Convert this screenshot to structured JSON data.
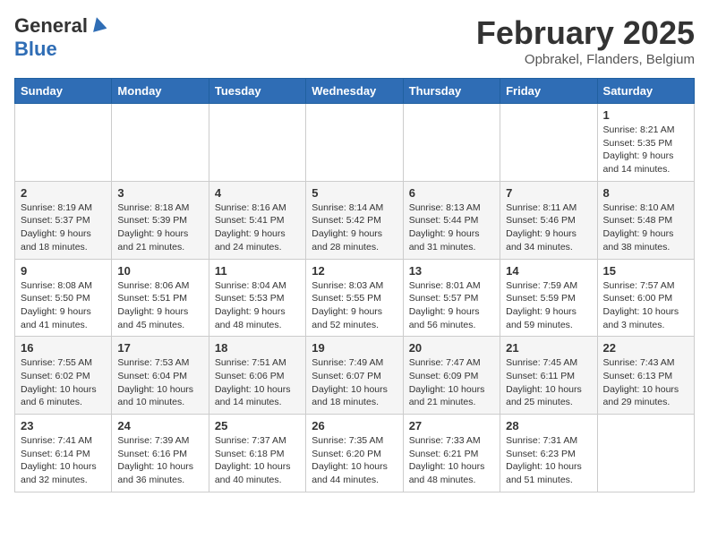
{
  "header": {
    "logo_general": "General",
    "logo_blue": "Blue",
    "month_title": "February 2025",
    "location": "Opbrakel, Flanders, Belgium"
  },
  "days_of_week": [
    "Sunday",
    "Monday",
    "Tuesday",
    "Wednesday",
    "Thursday",
    "Friday",
    "Saturday"
  ],
  "weeks": [
    [
      {
        "day": "",
        "info": ""
      },
      {
        "day": "",
        "info": ""
      },
      {
        "day": "",
        "info": ""
      },
      {
        "day": "",
        "info": ""
      },
      {
        "day": "",
        "info": ""
      },
      {
        "day": "",
        "info": ""
      },
      {
        "day": "1",
        "info": "Sunrise: 8:21 AM\nSunset: 5:35 PM\nDaylight: 9 hours and 14 minutes."
      }
    ],
    [
      {
        "day": "2",
        "info": "Sunrise: 8:19 AM\nSunset: 5:37 PM\nDaylight: 9 hours and 18 minutes."
      },
      {
        "day": "3",
        "info": "Sunrise: 8:18 AM\nSunset: 5:39 PM\nDaylight: 9 hours and 21 minutes."
      },
      {
        "day": "4",
        "info": "Sunrise: 8:16 AM\nSunset: 5:41 PM\nDaylight: 9 hours and 24 minutes."
      },
      {
        "day": "5",
        "info": "Sunrise: 8:14 AM\nSunset: 5:42 PM\nDaylight: 9 hours and 28 minutes."
      },
      {
        "day": "6",
        "info": "Sunrise: 8:13 AM\nSunset: 5:44 PM\nDaylight: 9 hours and 31 minutes."
      },
      {
        "day": "7",
        "info": "Sunrise: 8:11 AM\nSunset: 5:46 PM\nDaylight: 9 hours and 34 minutes."
      },
      {
        "day": "8",
        "info": "Sunrise: 8:10 AM\nSunset: 5:48 PM\nDaylight: 9 hours and 38 minutes."
      }
    ],
    [
      {
        "day": "9",
        "info": "Sunrise: 8:08 AM\nSunset: 5:50 PM\nDaylight: 9 hours and 41 minutes."
      },
      {
        "day": "10",
        "info": "Sunrise: 8:06 AM\nSunset: 5:51 PM\nDaylight: 9 hours and 45 minutes."
      },
      {
        "day": "11",
        "info": "Sunrise: 8:04 AM\nSunset: 5:53 PM\nDaylight: 9 hours and 48 minutes."
      },
      {
        "day": "12",
        "info": "Sunrise: 8:03 AM\nSunset: 5:55 PM\nDaylight: 9 hours and 52 minutes."
      },
      {
        "day": "13",
        "info": "Sunrise: 8:01 AM\nSunset: 5:57 PM\nDaylight: 9 hours and 56 minutes."
      },
      {
        "day": "14",
        "info": "Sunrise: 7:59 AM\nSunset: 5:59 PM\nDaylight: 9 hours and 59 minutes."
      },
      {
        "day": "15",
        "info": "Sunrise: 7:57 AM\nSunset: 6:00 PM\nDaylight: 10 hours and 3 minutes."
      }
    ],
    [
      {
        "day": "16",
        "info": "Sunrise: 7:55 AM\nSunset: 6:02 PM\nDaylight: 10 hours and 6 minutes."
      },
      {
        "day": "17",
        "info": "Sunrise: 7:53 AM\nSunset: 6:04 PM\nDaylight: 10 hours and 10 minutes."
      },
      {
        "day": "18",
        "info": "Sunrise: 7:51 AM\nSunset: 6:06 PM\nDaylight: 10 hours and 14 minutes."
      },
      {
        "day": "19",
        "info": "Sunrise: 7:49 AM\nSunset: 6:07 PM\nDaylight: 10 hours and 18 minutes."
      },
      {
        "day": "20",
        "info": "Sunrise: 7:47 AM\nSunset: 6:09 PM\nDaylight: 10 hours and 21 minutes."
      },
      {
        "day": "21",
        "info": "Sunrise: 7:45 AM\nSunset: 6:11 PM\nDaylight: 10 hours and 25 minutes."
      },
      {
        "day": "22",
        "info": "Sunrise: 7:43 AM\nSunset: 6:13 PM\nDaylight: 10 hours and 29 minutes."
      }
    ],
    [
      {
        "day": "23",
        "info": "Sunrise: 7:41 AM\nSunset: 6:14 PM\nDaylight: 10 hours and 32 minutes."
      },
      {
        "day": "24",
        "info": "Sunrise: 7:39 AM\nSunset: 6:16 PM\nDaylight: 10 hours and 36 minutes."
      },
      {
        "day": "25",
        "info": "Sunrise: 7:37 AM\nSunset: 6:18 PM\nDaylight: 10 hours and 40 minutes."
      },
      {
        "day": "26",
        "info": "Sunrise: 7:35 AM\nSunset: 6:20 PM\nDaylight: 10 hours and 44 minutes."
      },
      {
        "day": "27",
        "info": "Sunrise: 7:33 AM\nSunset: 6:21 PM\nDaylight: 10 hours and 48 minutes."
      },
      {
        "day": "28",
        "info": "Sunrise: 7:31 AM\nSunset: 6:23 PM\nDaylight: 10 hours and 51 minutes."
      },
      {
        "day": "",
        "info": ""
      }
    ]
  ]
}
